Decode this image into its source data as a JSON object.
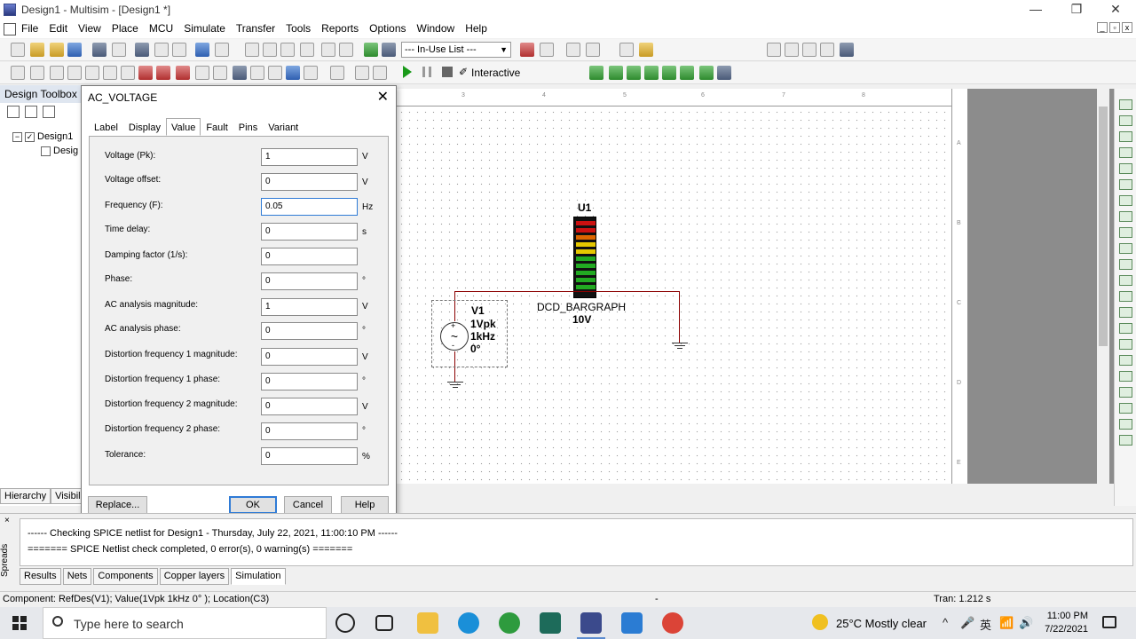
{
  "window": {
    "title": "Design1 - Multisim - [Design1 *]",
    "minimize": "—",
    "restore": "❐",
    "close": "✕"
  },
  "menu": [
    "File",
    "Edit",
    "View",
    "Place",
    "MCU",
    "Simulate",
    "Transfer",
    "Tools",
    "Reports",
    "Options",
    "Window",
    "Help"
  ],
  "toolbar": {
    "in_use_list": "--- In-Use List ---",
    "interactive_label": "Interactive",
    "interactive_icon": "✐"
  },
  "toolbox": {
    "title": "Design Toolbox",
    "tree_root": "Design1",
    "tree_child": "Desig",
    "tabs": [
      "Hierarchy",
      "Visibili"
    ]
  },
  "schematic": {
    "u1_ref": "U1",
    "u1_name": "DCD_BARGRAPH",
    "u1_value": "10V",
    "v1_ref": "V1",
    "v1_amp": "1Vpk",
    "v1_freq": "1kHz",
    "v1_phase": "0°",
    "plus": "+",
    "minus": "-",
    "ruler_top": [
      "3",
      "4",
      "5",
      "6",
      "7",
      "8"
    ],
    "ruler_right": [
      "A",
      "B",
      "C",
      "D",
      "E"
    ],
    "led_colors": [
      "#cc1111",
      "#cc1111",
      "#dd6600",
      "#e6c800",
      "#e6c800",
      "#22aa22",
      "#22aa22",
      "#22aa22",
      "#22aa22",
      "#22aa22"
    ]
  },
  "dialog": {
    "title": "AC_VOLTAGE",
    "close": "✕",
    "tabs": [
      "Label",
      "Display",
      "Value",
      "Fault",
      "Pins",
      "Variant"
    ],
    "active_tab": "Value",
    "rows": [
      {
        "label": "Voltage (Pk):",
        "value": "1",
        "unit": "V"
      },
      {
        "label": "Voltage offset:",
        "value": "0",
        "unit": "V"
      },
      {
        "label": "Frequency (F):",
        "value": "0.05",
        "unit": "Hz"
      },
      {
        "label": "Time delay:",
        "value": "0",
        "unit": "s"
      },
      {
        "label": "Damping factor (1/s):",
        "value": "0",
        "unit": ""
      },
      {
        "label": "Phase:",
        "value": "0",
        "unit": "°"
      },
      {
        "label": "AC analysis magnitude:",
        "value": "1",
        "unit": "V"
      },
      {
        "label": "AC analysis phase:",
        "value": "0",
        "unit": "°"
      },
      {
        "label": "Distortion frequency 1 magnitude:",
        "value": "0",
        "unit": "V"
      },
      {
        "label": "Distortion frequency 1 phase:",
        "value": "0",
        "unit": "°"
      },
      {
        "label": "Distortion frequency 2 magnitude:",
        "value": "0",
        "unit": "V"
      },
      {
        "label": "Distortion frequency 2 phase:",
        "value": "0",
        "unit": "°"
      },
      {
        "label": "Tolerance:",
        "value": "0",
        "unit": "%"
      }
    ],
    "buttons": {
      "replace": "Replace...",
      "ok": "OK",
      "cancel": "Cancel",
      "help": "Help"
    }
  },
  "spreadsheet": {
    "close": "×",
    "vertical_label": "Spreads",
    "lines": [
      "------ Checking SPICE netlist for Design1 - Thursday, July 22, 2021, 11:00:10 PM ------",
      "======= SPICE Netlist check completed, 0 error(s), 0 warning(s) ======="
    ],
    "tabs": [
      "Results",
      "Nets",
      "Components",
      "Copper layers",
      "Simulation"
    ],
    "active_tab": "Simulation"
  },
  "status": {
    "component": "Component: RefDes(V1); Value(1Vpk  1kHz  0° ); Location(C3)",
    "separator": "-",
    "tran": "Tran: 1.212 s"
  },
  "taskbar": {
    "search_placeholder": "Type here to search",
    "weather": "25°C  Mostly clear",
    "time": "11:00 PM",
    "date": "7/22/2021",
    "tray_icons": [
      "^",
      "🎤",
      "英",
      "📶",
      "🔊"
    ]
  }
}
